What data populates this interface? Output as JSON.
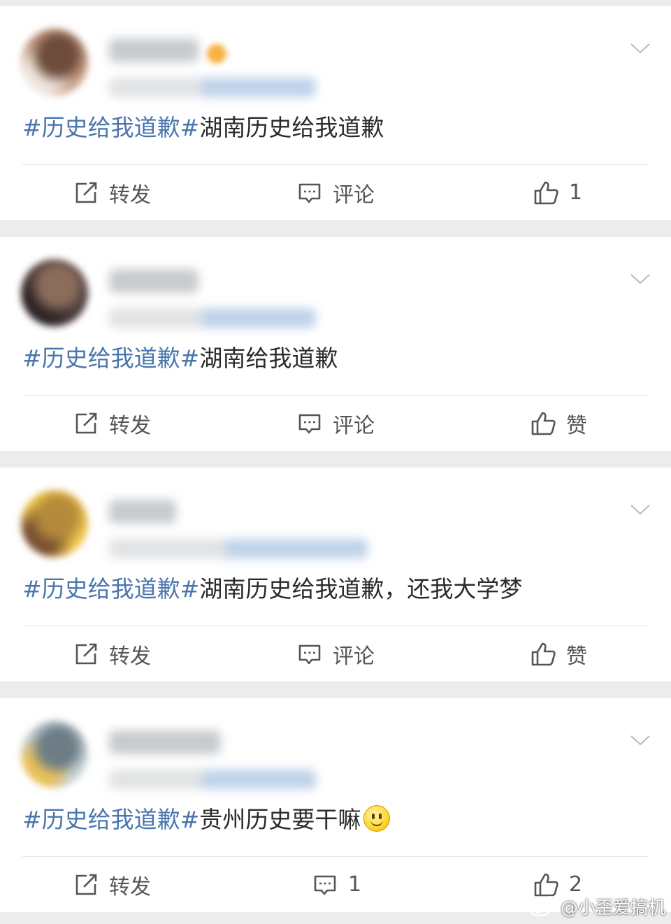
{
  "posts": [
    {
      "hashtag": "#历史给我道歉#",
      "body": "湖南历史给我道歉",
      "repost_label": "转发",
      "comment_label": "评论",
      "like_label": "1",
      "has_emoji": false,
      "avatar_colors": [
        "#c9a089",
        "#6e4b3a",
        "#efe5dc"
      ]
    },
    {
      "hashtag": "#历史给我道歉#",
      "body": "湖南给我道歉",
      "repost_label": "转发",
      "comment_label": "评论",
      "like_label": "赞",
      "has_emoji": false,
      "avatar_colors": [
        "#4a3b3a",
        "#8c6d5c",
        "#2d2424"
      ]
    },
    {
      "hashtag": "#历史给我道歉#",
      "body": "湖南历史给我道歉，还我大学梦",
      "repost_label": "转发",
      "comment_label": "评论",
      "like_label": "赞",
      "has_emoji": false,
      "avatar_colors": [
        "#f0c64a",
        "#b58a3a",
        "#7a5234"
      ]
    },
    {
      "hashtag": "#历史给我道歉#",
      "body": "贵州历史要干嘛",
      "repost_label": "转发",
      "comment_label": "1",
      "like_label": "2",
      "has_emoji": true,
      "avatar_colors": [
        "#c7d3da",
        "#6d7d86",
        "#e9c15a"
      ]
    }
  ],
  "watermark": "@小歪爱搞机",
  "colors": {
    "hashtag": "#4a76ad",
    "text": "#2b2b2b",
    "action": "#555555",
    "background": "#ececec"
  }
}
